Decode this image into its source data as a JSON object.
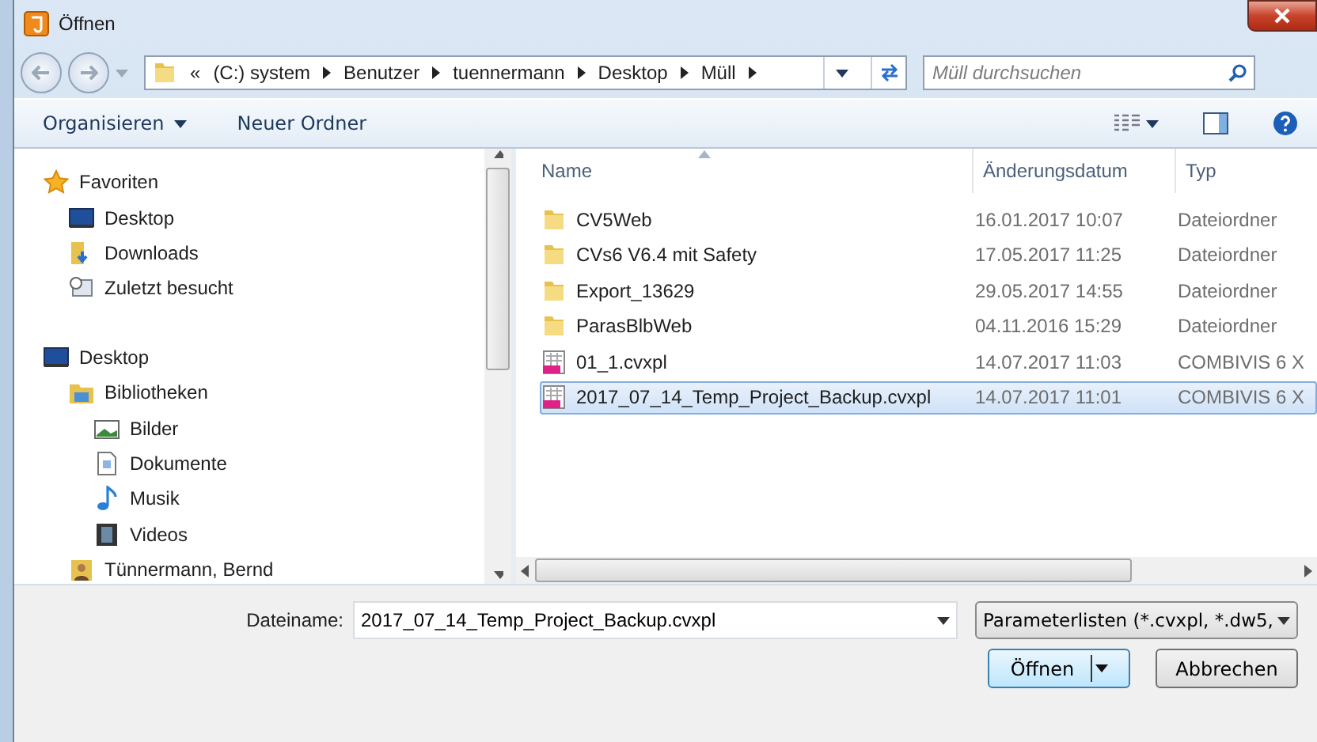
{
  "window": {
    "title": "Öffnen"
  },
  "address": {
    "overflow": "«",
    "segments": [
      "(C:) system",
      "Benutzer",
      "tuennermann",
      "Desktop",
      "Müll"
    ]
  },
  "search": {
    "placeholder": "Müll durchsuchen"
  },
  "toolbar": {
    "organize": "Organisieren",
    "new_folder": "Neuer Ordner"
  },
  "navigation": [
    {
      "label": "Favoriten",
      "kind": "favorites",
      "children": [
        {
          "label": "Desktop",
          "kind": "desktop"
        },
        {
          "label": "Downloads",
          "kind": "downloads"
        },
        {
          "label": "Zuletzt besucht",
          "kind": "recent"
        }
      ]
    },
    {
      "label": "Desktop",
      "kind": "desktop",
      "children": [
        {
          "label": "Bibliotheken",
          "kind": "library",
          "children": [
            {
              "label": "Bilder",
              "kind": "pictures"
            },
            {
              "label": "Dokumente",
              "kind": "documents"
            },
            {
              "label": "Musik",
              "kind": "music"
            },
            {
              "label": "Videos",
              "kind": "videos"
            }
          ]
        },
        {
          "label": "Tünnermann, Bernd",
          "kind": "user"
        }
      ]
    }
  ],
  "table": {
    "columns": [
      "Name",
      "Änderungsdatum",
      "Typ"
    ],
    "rows": [
      {
        "kind": "folder",
        "name": "CV5Web",
        "date": "16.01.2017 10:07",
        "type": "Dateiordner",
        "selected": false
      },
      {
        "kind": "folder",
        "name": "CVs6 V6.4 mit Safety",
        "date": "17.05.2017 11:25",
        "type": "Dateiordner",
        "selected": false
      },
      {
        "kind": "folder",
        "name": "Export_13629",
        "date": "29.05.2017 14:55",
        "type": "Dateiordner",
        "selected": false
      },
      {
        "kind": "folder",
        "name": "ParasBlbWeb",
        "date": "04.11.2016 15:29",
        "type": "Dateiordner",
        "selected": false
      },
      {
        "kind": "file",
        "name": "01_1.cvxpl",
        "date": "14.07.2017 11:03",
        "type": "COMBIVIS 6 X",
        "selected": false
      },
      {
        "kind": "file",
        "name": "2017_07_14_Temp_Project_Backup.cvxpl",
        "date": "14.07.2017 11:01",
        "type": "COMBIVIS 6 X",
        "selected": true
      }
    ]
  },
  "filename": {
    "label": "Dateiname:",
    "value": "2017_07_14_Temp_Project_Backup.cvxpl"
  },
  "filetype": {
    "value": "Parameterlisten (*.cvxpl, *.dw5,"
  },
  "buttons": {
    "open": "Öffnen",
    "cancel": "Abbrechen"
  }
}
